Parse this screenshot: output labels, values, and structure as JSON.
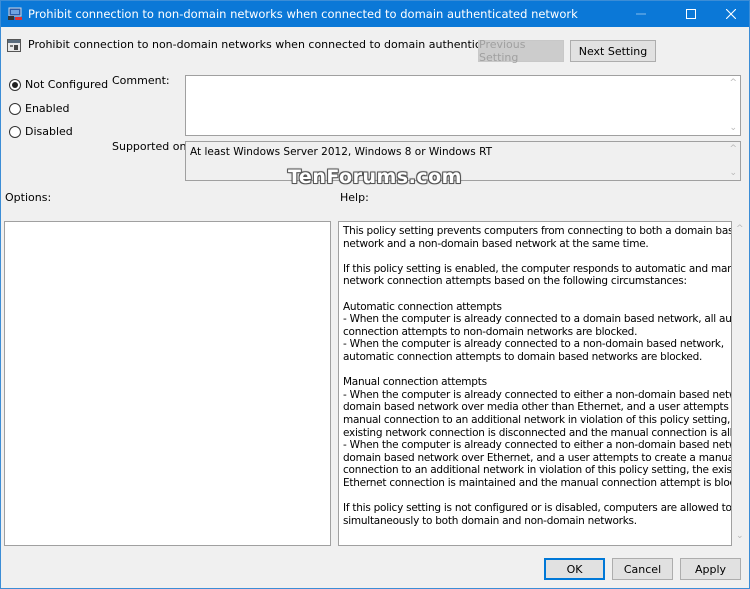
{
  "window": {
    "title": "Prohibit connection to non-domain networks when connected to domain authenticated network",
    "controls": {
      "minimize": "minimize-icon",
      "maximize": "maximize-icon",
      "close": "close-icon"
    },
    "accent_color": "#0b78d7"
  },
  "header": {
    "policy_name": "Prohibit connection to non-domain networks when connected to domain authenticated network",
    "previous_setting_label": "Previous Setting",
    "next_setting_label": "Next Setting"
  },
  "state": {
    "options": [
      {
        "label": "Not Configured",
        "checked": true
      },
      {
        "label": "Enabled",
        "checked": false
      },
      {
        "label": "Disabled",
        "checked": false
      }
    ]
  },
  "comment": {
    "label": "Comment:",
    "value": ""
  },
  "supported_on": {
    "label": "Supported on:",
    "value": "At least Windows Server 2012, Windows 8 or Windows RT"
  },
  "watermark": "TenForums.com",
  "options_section": {
    "label": "Options:"
  },
  "help_section": {
    "label": "Help:",
    "lines": [
      "This policy setting prevents computers from connecting to both a domain based",
      "network and a non-domain based network at the same time.",
      "",
      "If this policy setting is enabled, the computer responds to automatic and manual",
      "network connection attempts based on the following circumstances:",
      "",
      "Automatic connection attempts",
      "- When the computer is already connected to a domain based network, all automatic",
      "connection attempts to non-domain networks are blocked.",
      "- When the computer is already connected to a non-domain based network,",
      "automatic connection attempts to domain based networks are blocked.",
      "",
      "Manual connection attempts",
      "- When the computer is already connected to either a non-domain based network or a",
      "domain based network over media other than Ethernet, and a user attempts to create a",
      "manual connection to an additional network in violation of this policy setting, the",
      "existing network connection is disconnected and the manual connection is allowed.",
      "- When the computer is already connected to either a non-domain based network or a",
      "domain based network over Ethernet, and a user attempts to create a manual",
      "connection to an additional network in violation of this policy setting, the existing",
      "Ethernet connection is maintained and the manual connection attempt is blocked.",
      "",
      "If this policy setting is not configured or is disabled, computers are allowed to connect",
      "simultaneously to both domain and non-domain networks."
    ]
  },
  "footer": {
    "ok_label": "OK",
    "cancel_label": "Cancel",
    "apply_label": "Apply"
  }
}
